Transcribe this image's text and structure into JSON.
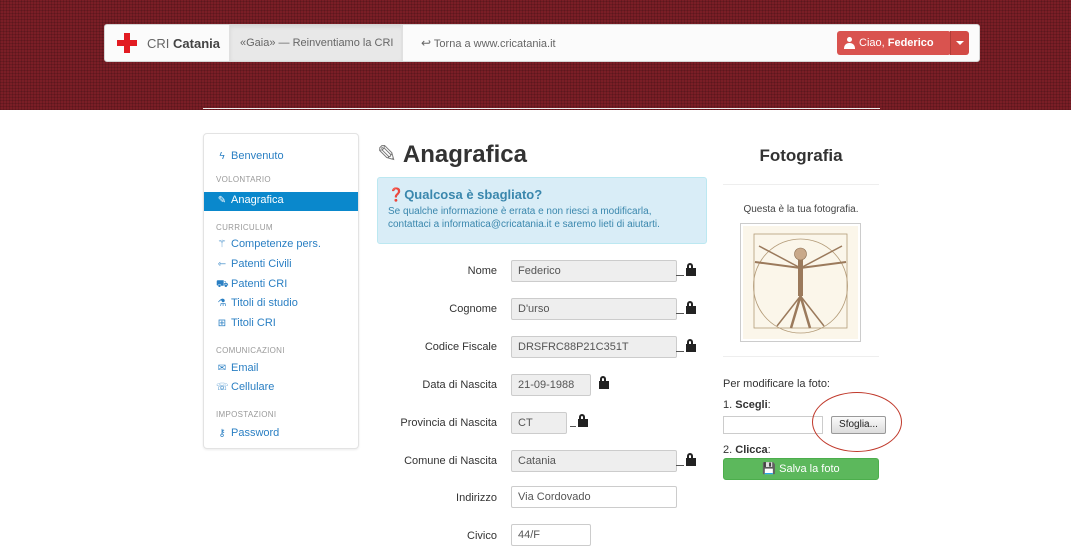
{
  "navbar": {
    "brand_prefix": "CRI",
    "brand_name": "Catania",
    "tagline": "«Gaia» — Reinventiamo la CRI",
    "back_link": "Torna a www.cricatania.it",
    "user_greeting": "Ciao,",
    "user_name": "Federico"
  },
  "sidebar": {
    "welcome": "Benvenuto",
    "sections": [
      {
        "heading": "VOLONTARIO",
        "items": [
          "Anagrafica"
        ]
      },
      {
        "heading": "CURRICULUM",
        "items": [
          "Competenze pers.",
          "Patenti Civili",
          "Patenti CRI",
          "Titoli di studio",
          "Titoli CRI"
        ]
      },
      {
        "heading": "COMUNICAZIONI",
        "items": [
          "Email",
          "Cellulare"
        ]
      },
      {
        "heading": "IMPOSTAZIONI",
        "items": [
          "Password"
        ]
      }
    ],
    "active_item": "Anagrafica"
  },
  "main": {
    "title": "Anagrafica",
    "alert_heading": "Qualcosa è sbagliato?",
    "alert_line1": "Se qualche informazione è errata e non riesci a modificarla,",
    "alert_line2": "contattaci a informatica@cricatania.it e saremo lieti di aiutarti.",
    "fields": [
      {
        "label": "Nome",
        "value": "Federico",
        "readonly": true
      },
      {
        "label": "Cognome",
        "value": "D'urso",
        "readonly": true
      },
      {
        "label": "Codice Fiscale",
        "value": "DRSFRC88P21C351T",
        "readonly": true
      },
      {
        "label": "Data di Nascita",
        "value": "21-09-1988",
        "readonly": true
      },
      {
        "label": "Provincia di Nascita",
        "value": "CT",
        "readonly": true
      },
      {
        "label": "Comune di Nascita",
        "value": "Catania",
        "readonly": true
      },
      {
        "label": "Indirizzo",
        "value": "Via Cordovado",
        "readonly": false
      },
      {
        "label": "Civico",
        "value": "44/F",
        "readonly": false
      }
    ]
  },
  "photo": {
    "title": "Fotografia",
    "caption": "Questa è la tua fotografia.",
    "modify_text": "Per modificare la foto:",
    "step1_prefix": "1.",
    "step1_label": "Scegli",
    "browse_label": "Sfoglia...",
    "step2_prefix": "2.",
    "step2_label": "Clicca",
    "save_label": "Salva la foto"
  },
  "colors": {
    "brand_red": "#e21b22",
    "user_button": "#d9534f",
    "sidebar_active": "#0a88cc",
    "link": "#2a7fc3",
    "alert_bg": "#d9edf7",
    "save_green": "#5cb85c",
    "annotation_circle": "#c0392b"
  },
  "icons": {
    "welcome": "bolt-icon",
    "anagrafica": "edit-icon",
    "competenze": "magic-wand-icon",
    "patenti_civili": "road-icon",
    "patenti_cri": "truck-icon",
    "titoli_studio": "flask-icon",
    "titoli_cri": "plus-square-icon",
    "email": "envelope-icon",
    "cellulare": "phone-icon",
    "password": "key-icon",
    "alert": "question-circle-icon",
    "lock": "lock-icon",
    "user": "user-icon",
    "save": "floppy-disk-icon",
    "back": "reply-arrow-icon"
  }
}
